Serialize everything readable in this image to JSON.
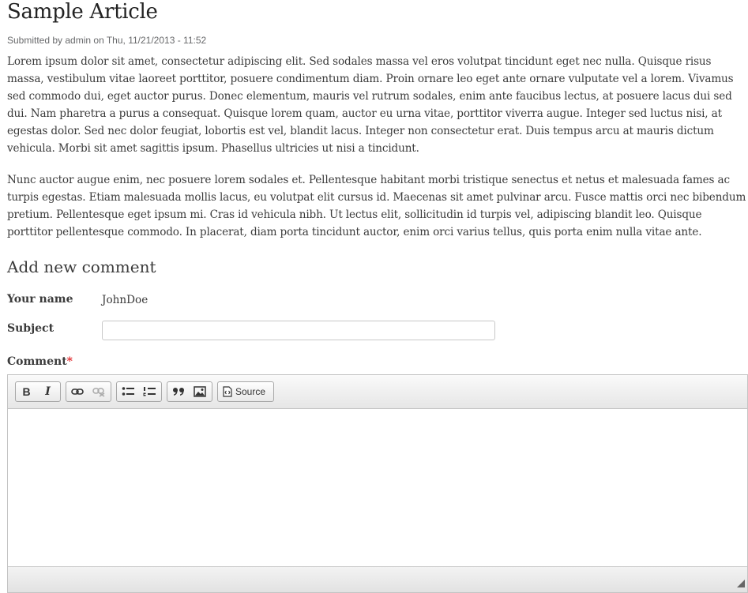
{
  "article": {
    "title": "Sample Article",
    "meta": "Submitted by admin on Thu, 11/21/2013 - 11:52",
    "paragraphs": [
      "Lorem ipsum dolor sit amet, consectetur adipiscing elit. Sed sodales massa vel eros volutpat tincidunt eget nec nulla. Quisque risus massa, vestibulum vitae laoreet porttitor, posuere condimentum diam. Proin ornare leo eget ante ornare vulputate vel a lorem. Vivamus sed commodo dui, eget auctor purus. Donec elementum, mauris vel rutrum sodales, enim ante faucibus lectus, at posuere lacus dui sed dui. Nam pharetra a purus a consequat. Quisque lorem quam, auctor eu urna vitae, porttitor viverra augue. Integer sed luctus nisi, at egestas dolor. Sed nec dolor feugiat, lobortis est vel, blandit lacus. Integer non consectetur erat. Duis tempus arcu at mauris dictum vehicula. Morbi sit amet sagittis ipsum. Phasellus ultricies ut nisi a tincidunt.",
      "Nunc auctor augue enim, nec posuere lorem sodales et. Pellentesque habitant morbi tristique senectus et netus et malesuada fames ac turpis egestas. Etiam malesuada mollis lacus, eu volutpat elit cursus id. Maecenas sit amet pulvinar arcu. Fusce mattis orci nec bibendum pretium. Pellentesque eget ipsum mi. Cras id vehicula nibh. Ut lectus elit, sollicitudin id turpis vel, adipiscing blandit leo. Quisque porttitor pellentesque commodo. In placerat, diam porta tincidunt auctor, enim orci varius tellus, quis porta enim nulla vitae ante."
    ]
  },
  "comment_form": {
    "heading": "Add new comment",
    "name_label": "Your name",
    "name_value": "JohnDoe",
    "subject_label": "Subject",
    "subject_value": "",
    "comment_label": "Comment",
    "required_marker": "*",
    "toolbar": {
      "bold": "B",
      "italic": "I",
      "source_label": "Source",
      "icons": [
        "bold-icon",
        "italic-icon",
        "link-icon",
        "unlink-icon",
        "bulleted-list-icon",
        "numbered-list-icon",
        "blockquote-icon",
        "image-icon",
        "source-icon"
      ]
    }
  },
  "colors": {
    "text": "#3b3b3b",
    "required": "#e0262a",
    "meta": "#68696b"
  }
}
